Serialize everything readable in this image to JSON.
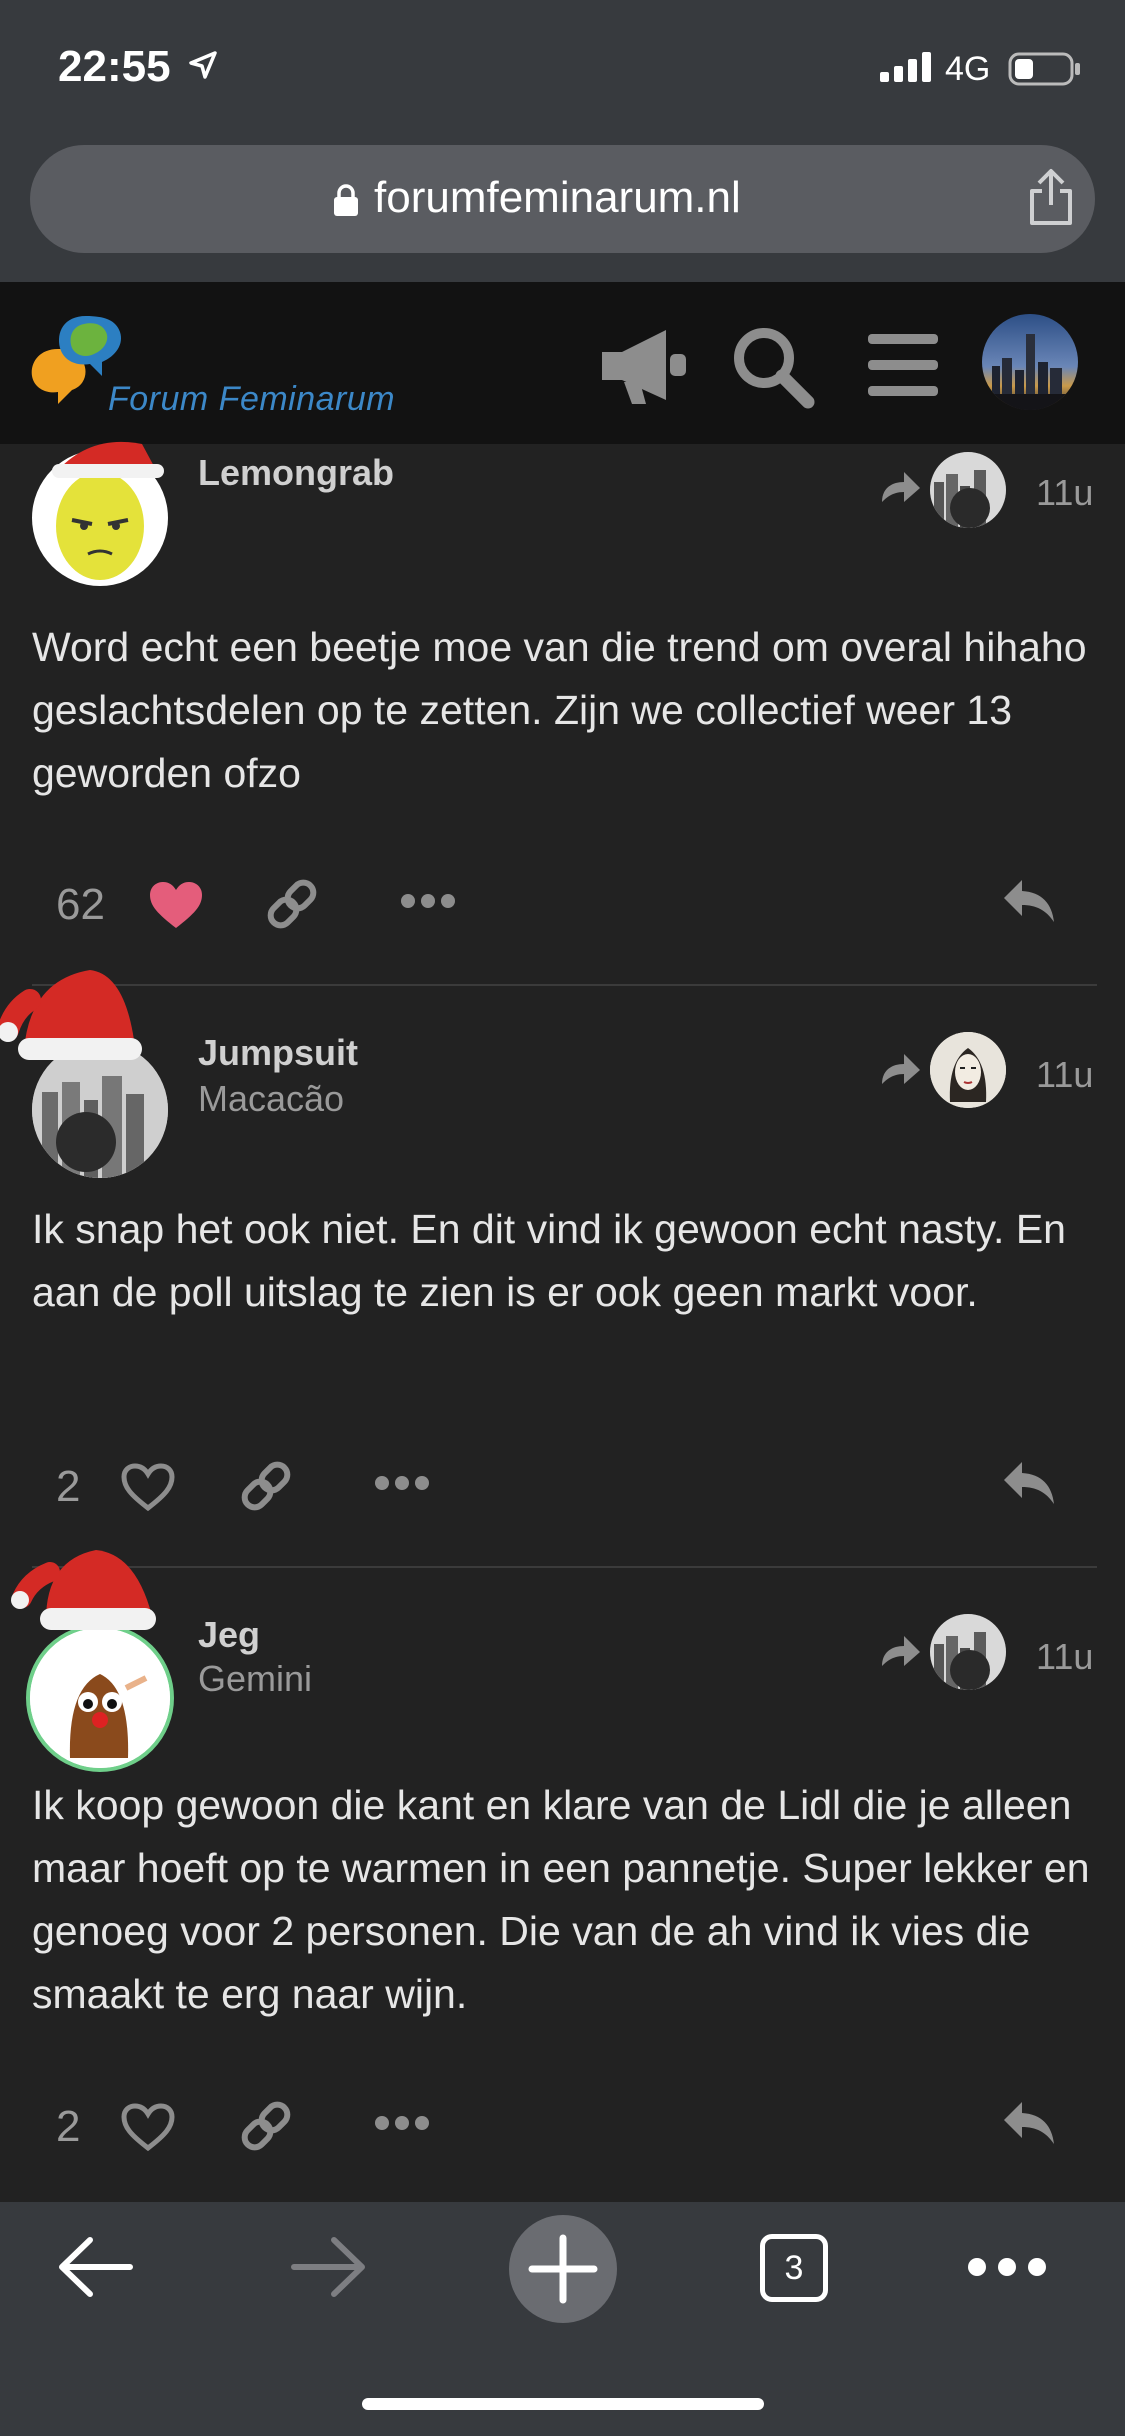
{
  "status_bar": {
    "time": "22:55",
    "network": "4G"
  },
  "browser": {
    "url": "forumfeminarum.nl",
    "tab_count": "3"
  },
  "forum": {
    "name": "Forum Feminarum"
  },
  "posts": [
    {
      "username": "Lemongrab",
      "user_title": "",
      "age": "11u",
      "body": "Word echt een beetje moe van die trend om overal hihaho geslachtsdelen op te zetten. Zijn we collectief weer 13 geworden ofzo",
      "likes": "62",
      "liked": true
    },
    {
      "username": "Jumpsuit",
      "user_title": "Macacão",
      "age": "11u",
      "body": "Ik snap het ook niet. En dit vind ik gewoon echt nasty. En aan de poll uitslag te zien is er ook geen markt voor.",
      "likes": "2",
      "liked": false
    },
    {
      "username": "Jeg",
      "user_title": "Gemini",
      "age": "11u",
      "body": "Ik koop gewoon die kant en klare van de Lidl die je alleen maar hoeft op te warmen in een pannetje. Super lekker en genoeg voor 2 personen. Die van de ah vind ik vies die smaakt te erg naar wijn.",
      "likes": "2",
      "liked": false
    }
  ],
  "icons": {
    "status": [
      "location-arrow-icon",
      "signal-icon",
      "battery-icon"
    ],
    "browser": [
      "lock-icon",
      "share-icon",
      "back-arrow-icon",
      "forward-arrow-icon",
      "new-tab-plus-icon",
      "tabs-icon",
      "more-dots-icon"
    ],
    "forum_header": [
      "megaphone-icon",
      "search-icon",
      "menu-icon",
      "user-avatar"
    ],
    "post_actions": [
      "heart-icon",
      "link-icon",
      "more-icon",
      "reply-icon"
    ]
  },
  "colors": {
    "accent_heart": "#e45d7b",
    "logo_blue": "#3c88c8",
    "background": "#222222"
  }
}
